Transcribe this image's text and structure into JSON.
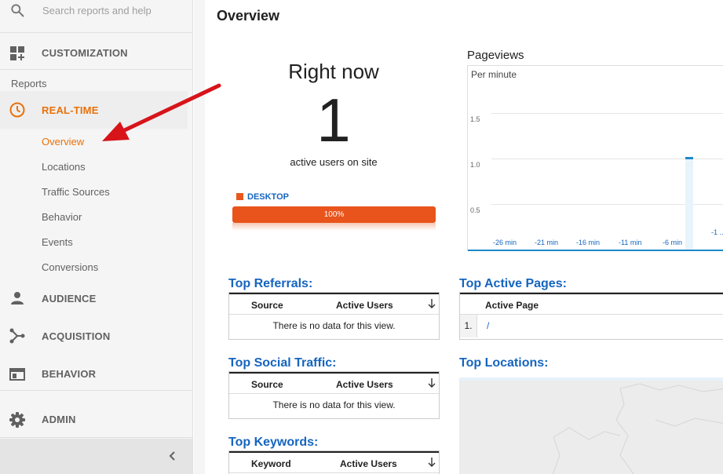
{
  "search": {
    "placeholder": "Search reports and help"
  },
  "sidebar": {
    "customization": "CUSTOMIZATION",
    "reports_heading": "Reports",
    "realtime": "REAL-TIME",
    "realtime_items": [
      "Overview",
      "Locations",
      "Traffic Sources",
      "Behavior",
      "Events",
      "Conversions"
    ],
    "audience": "AUDIENCE",
    "acquisition": "ACQUISITION",
    "behavior": "BEHAVIOR",
    "admin": "ADMIN"
  },
  "main": {
    "title": "Overview",
    "right_now": {
      "title": "Right now",
      "count": "1",
      "subtitle": "active users on site",
      "device_label": "DESKTOP",
      "device_percent": "100%",
      "device_color": "#e8541c"
    },
    "pageviews": {
      "title": "Pageviews",
      "unit": "Per minute",
      "y_ticks": [
        "1.5",
        "1.0",
        "0.5"
      ],
      "x_ticks": [
        "-26 min",
        "-21 min",
        "-16 min",
        "-11 min",
        "-6 min",
        "-1 ..."
      ]
    },
    "top_referrals": {
      "title": "Top Referrals:",
      "col1": "Source",
      "col2": "Active Users",
      "empty": "There is no data for this view."
    },
    "top_social": {
      "title": "Top Social Traffic:",
      "col1": "Source",
      "col2": "Active Users",
      "empty": "There is no data for this view."
    },
    "top_keywords": {
      "title": "Top Keywords:",
      "col1": "Keyword",
      "col2": "Active Users"
    },
    "top_pages": {
      "title": "Top Active Pages:",
      "col1": "Active Page",
      "rows": [
        {
          "num": "1.",
          "page": "/"
        }
      ]
    },
    "top_locations": {
      "title": "Top Locations:"
    }
  },
  "chart_data": {
    "type": "bar",
    "title": "Pageviews",
    "ylabel": "Per minute",
    "categories": [
      "-26 min",
      "-21 min",
      "-16 min",
      "-11 min",
      "-6 min",
      "-1 ..."
    ],
    "y_ticks": [
      0.5,
      1.0,
      1.5
    ],
    "bars": [
      {
        "x": "-4 min",
        "value": 1
      }
    ],
    "ylim": [
      0,
      1.5
    ]
  },
  "colors": {
    "accent": "#e8710a",
    "link": "#1565c0",
    "chart": "#1e88c8"
  }
}
